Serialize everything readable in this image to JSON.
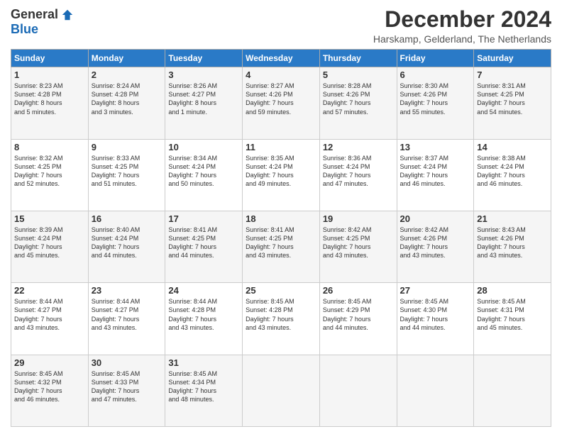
{
  "logo": {
    "general": "General",
    "blue": "Blue"
  },
  "header": {
    "month_year": "December 2024",
    "location": "Harskamp, Gelderland, The Netherlands"
  },
  "days_of_week": [
    "Sunday",
    "Monday",
    "Tuesday",
    "Wednesday",
    "Thursday",
    "Friday",
    "Saturday"
  ],
  "weeks": [
    [
      {
        "day": "1",
        "content": "Sunrise: 8:23 AM\nSunset: 4:28 PM\nDaylight: 8 hours\nand 5 minutes."
      },
      {
        "day": "2",
        "content": "Sunrise: 8:24 AM\nSunset: 4:28 PM\nDaylight: 8 hours\nand 3 minutes."
      },
      {
        "day": "3",
        "content": "Sunrise: 8:26 AM\nSunset: 4:27 PM\nDaylight: 8 hours\nand 1 minute."
      },
      {
        "day": "4",
        "content": "Sunrise: 8:27 AM\nSunset: 4:26 PM\nDaylight: 7 hours\nand 59 minutes."
      },
      {
        "day": "5",
        "content": "Sunrise: 8:28 AM\nSunset: 4:26 PM\nDaylight: 7 hours\nand 57 minutes."
      },
      {
        "day": "6",
        "content": "Sunrise: 8:30 AM\nSunset: 4:26 PM\nDaylight: 7 hours\nand 55 minutes."
      },
      {
        "day": "7",
        "content": "Sunrise: 8:31 AM\nSunset: 4:25 PM\nDaylight: 7 hours\nand 54 minutes."
      }
    ],
    [
      {
        "day": "8",
        "content": "Sunrise: 8:32 AM\nSunset: 4:25 PM\nDaylight: 7 hours\nand 52 minutes."
      },
      {
        "day": "9",
        "content": "Sunrise: 8:33 AM\nSunset: 4:25 PM\nDaylight: 7 hours\nand 51 minutes."
      },
      {
        "day": "10",
        "content": "Sunrise: 8:34 AM\nSunset: 4:24 PM\nDaylight: 7 hours\nand 50 minutes."
      },
      {
        "day": "11",
        "content": "Sunrise: 8:35 AM\nSunset: 4:24 PM\nDaylight: 7 hours\nand 49 minutes."
      },
      {
        "day": "12",
        "content": "Sunrise: 8:36 AM\nSunset: 4:24 PM\nDaylight: 7 hours\nand 47 minutes."
      },
      {
        "day": "13",
        "content": "Sunrise: 8:37 AM\nSunset: 4:24 PM\nDaylight: 7 hours\nand 46 minutes."
      },
      {
        "day": "14",
        "content": "Sunrise: 8:38 AM\nSunset: 4:24 PM\nDaylight: 7 hours\nand 46 minutes."
      }
    ],
    [
      {
        "day": "15",
        "content": "Sunrise: 8:39 AM\nSunset: 4:24 PM\nDaylight: 7 hours\nand 45 minutes."
      },
      {
        "day": "16",
        "content": "Sunrise: 8:40 AM\nSunset: 4:24 PM\nDaylight: 7 hours\nand 44 minutes."
      },
      {
        "day": "17",
        "content": "Sunrise: 8:41 AM\nSunset: 4:25 PM\nDaylight: 7 hours\nand 44 minutes."
      },
      {
        "day": "18",
        "content": "Sunrise: 8:41 AM\nSunset: 4:25 PM\nDaylight: 7 hours\nand 43 minutes."
      },
      {
        "day": "19",
        "content": "Sunrise: 8:42 AM\nSunset: 4:25 PM\nDaylight: 7 hours\nand 43 minutes."
      },
      {
        "day": "20",
        "content": "Sunrise: 8:42 AM\nSunset: 4:26 PM\nDaylight: 7 hours\nand 43 minutes."
      },
      {
        "day": "21",
        "content": "Sunrise: 8:43 AM\nSunset: 4:26 PM\nDaylight: 7 hours\nand 43 minutes."
      }
    ],
    [
      {
        "day": "22",
        "content": "Sunrise: 8:44 AM\nSunset: 4:27 PM\nDaylight: 7 hours\nand 43 minutes."
      },
      {
        "day": "23",
        "content": "Sunrise: 8:44 AM\nSunset: 4:27 PM\nDaylight: 7 hours\nand 43 minutes."
      },
      {
        "day": "24",
        "content": "Sunrise: 8:44 AM\nSunset: 4:28 PM\nDaylight: 7 hours\nand 43 minutes."
      },
      {
        "day": "25",
        "content": "Sunrise: 8:45 AM\nSunset: 4:28 PM\nDaylight: 7 hours\nand 43 minutes."
      },
      {
        "day": "26",
        "content": "Sunrise: 8:45 AM\nSunset: 4:29 PM\nDaylight: 7 hours\nand 44 minutes."
      },
      {
        "day": "27",
        "content": "Sunrise: 8:45 AM\nSunset: 4:30 PM\nDaylight: 7 hours\nand 44 minutes."
      },
      {
        "day": "28",
        "content": "Sunrise: 8:45 AM\nSunset: 4:31 PM\nDaylight: 7 hours\nand 45 minutes."
      }
    ],
    [
      {
        "day": "29",
        "content": "Sunrise: 8:45 AM\nSunset: 4:32 PM\nDaylight: 7 hours\nand 46 minutes."
      },
      {
        "day": "30",
        "content": "Sunrise: 8:45 AM\nSunset: 4:33 PM\nDaylight: 7 hours\nand 47 minutes."
      },
      {
        "day": "31",
        "content": "Sunrise: 8:45 AM\nSunset: 4:34 PM\nDaylight: 7 hours\nand 48 minutes."
      },
      {
        "day": "",
        "content": ""
      },
      {
        "day": "",
        "content": ""
      },
      {
        "day": "",
        "content": ""
      },
      {
        "day": "",
        "content": ""
      }
    ]
  ]
}
